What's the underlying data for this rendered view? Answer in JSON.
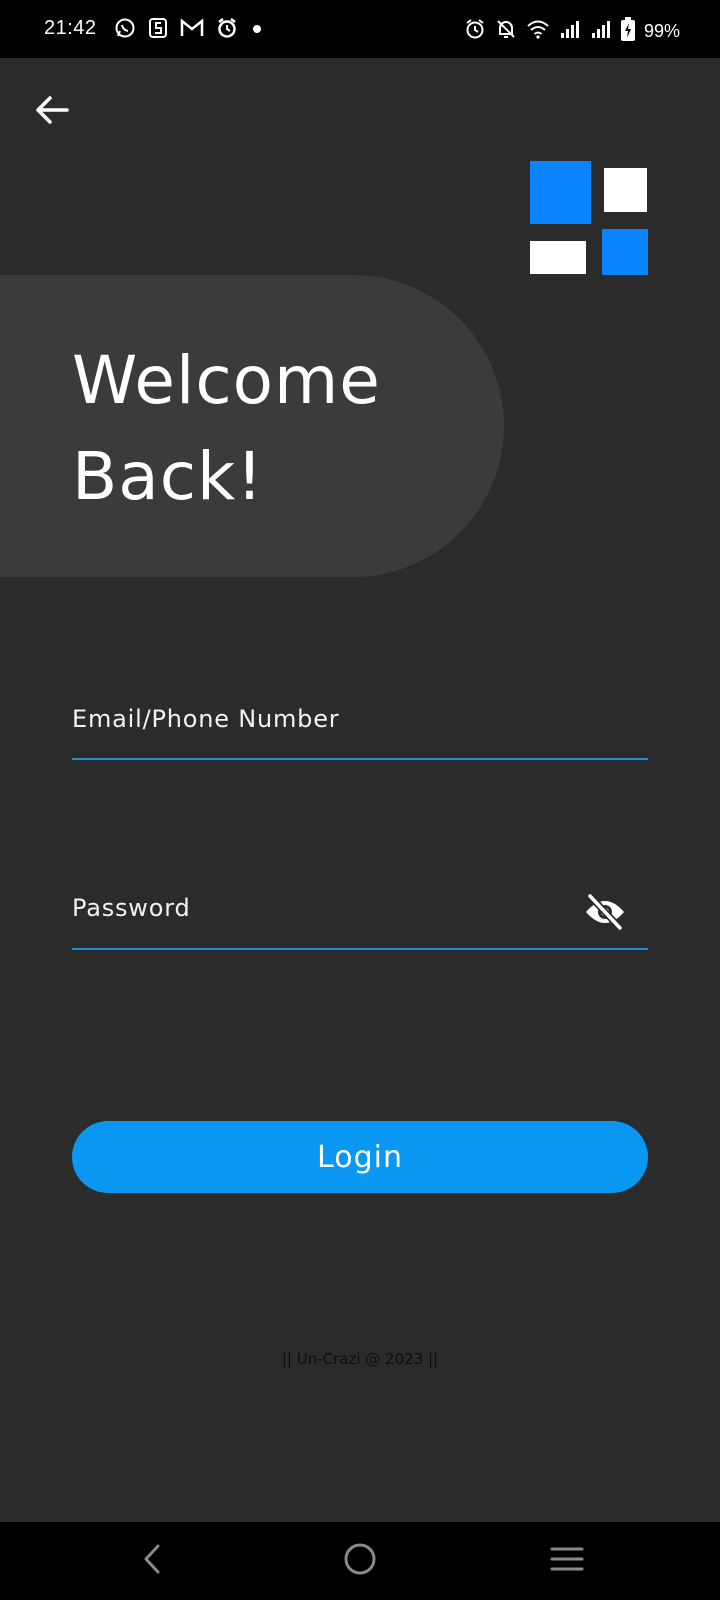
{
  "status_bar": {
    "time": "21:42",
    "left_icons": [
      "whatsapp-icon",
      "s-app-icon",
      "gmail-icon",
      "alarm-icon",
      "notification-dot"
    ],
    "right_icons": [
      "alarm-icon",
      "notifications-off-icon",
      "wifi-icon",
      "signal-icon",
      "signal-icon",
      "battery-charging-icon"
    ],
    "battery_percent": "99%"
  },
  "header": {
    "back_icon": "arrow-left-icon"
  },
  "logo": {
    "colors": {
      "blue": "#0a84ff",
      "white": "#ffffff"
    }
  },
  "welcome": {
    "line1": "Welcome",
    "line2": "Back!"
  },
  "form": {
    "email_placeholder": "Email/Phone Number",
    "email_value": "",
    "password_placeholder": "Password",
    "password_value": "",
    "password_toggle_icon": "eye-off-icon",
    "login_label": "Login"
  },
  "footer": {
    "text": "|| Un-Crazi @ 2023 ||"
  },
  "nav_bar": {
    "icons": [
      "back-icon",
      "home-icon",
      "recents-icon"
    ]
  },
  "colors": {
    "background": "#2b2b2b",
    "panel": "#3b3b3b",
    "accent": "#0a98f2",
    "underline": "#1e8fe0"
  }
}
